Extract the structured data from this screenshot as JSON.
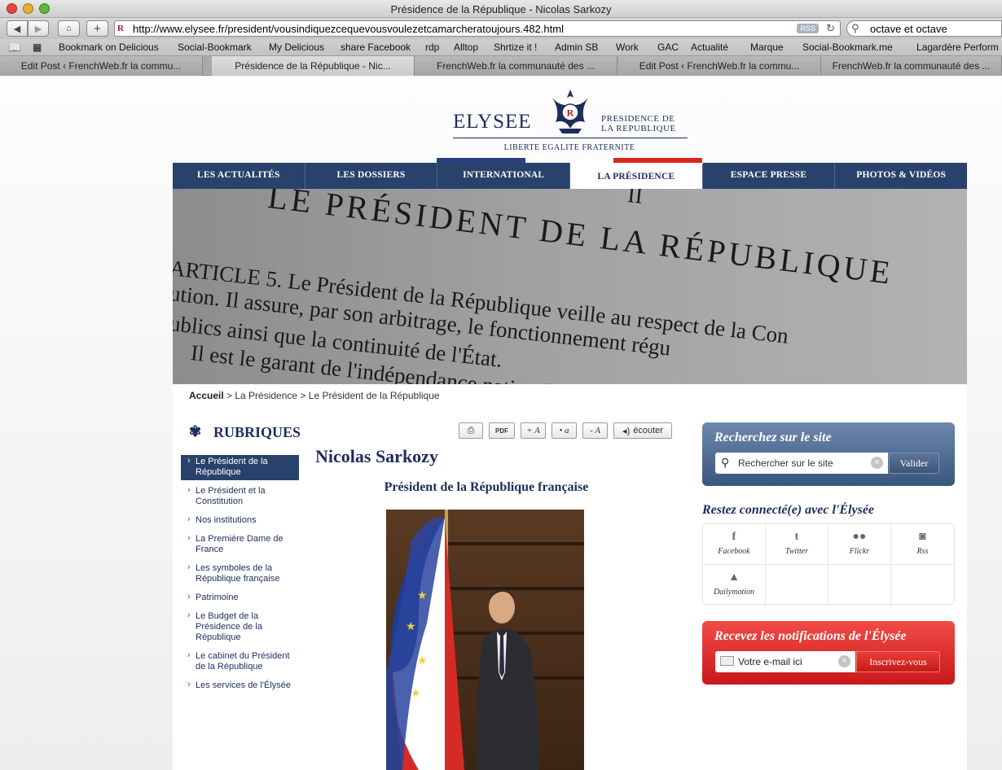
{
  "window": {
    "title": "Présidence de la République - Nicolas Sarkozy"
  },
  "toolbar": {
    "back_icon": "back-arrow-icon",
    "forward_icon": "forward-arrow-icon",
    "home_icon": "home-icon",
    "add_icon": "plus-icon",
    "url": "http://www.elysee.fr/president/vousindiquezcequevousvoulezetcamarcheratoujours.482.html",
    "rss_label": "RSS",
    "search_value": "octave et octave"
  },
  "bookmarks": [
    "Bookmark on Delicious",
    "Social-Bookmark",
    "My Delicious",
    "share Facebook",
    "rdp",
    "Alltop",
    "Shrtize it !",
    "Admin SB",
    "Work",
    "GAC",
    "Actualité",
    "Marque",
    "Social-Bookmark.me",
    "Lagardère Perform"
  ],
  "tabs": [
    {
      "label": "Edit Post ‹ FrenchWeb.fr la commu...",
      "active": false
    },
    {
      "label": "Présidence de la République - Nic...",
      "active": true
    },
    {
      "label": "FrenchWeb.fr la communauté des ...",
      "active": false
    },
    {
      "label": "Edit Post ‹ FrenchWeb.fr la commu...",
      "active": false
    },
    {
      "label": "FrenchWeb.fr la communauté des ...",
      "active": false
    }
  ],
  "site": {
    "logo_word": "ELYSEE",
    "logo_sub": [
      "PRESIDENCE DE",
      "LA REPUBLIQUE"
    ],
    "motto": "LIBERTE EGALITE FRATERNITE",
    "tricolor": [
      "#2a3f82",
      "#ffffff",
      "#d4261f"
    ]
  },
  "nav": [
    "LES ACTUALITÉS",
    "LES DOSSIERS",
    "INTERNATIONAL",
    "LA PRÉSIDENCE",
    "ESPACE PRESSE",
    "PHOTOS & VIDÉOS"
  ],
  "nav_active": "LA PRÉSIDENCE",
  "banner_lines": [
    "II",
    "LE PRÉSIDENT DE LA RÉPUBLIQUE",
    "ARTICLE 5.      Le Président de la République veille au respect de la Con",
    "ution. Il assure, par son arbitrage, le fonctionnement régu",
    "ublics ainsi que la continuité de l'État.",
    "Il est le garant de l'indépendance nationale,"
  ],
  "breadcrumb": {
    "home": "Accueil",
    "sep1": " > La Présidence > ",
    "current": "Le Président de la République"
  },
  "rubriques": {
    "title": "RUBRIQUES",
    "items": [
      {
        "label": "Le Président de la République",
        "active": true
      },
      {
        "label": "Le Président et la Constitution",
        "active": false
      },
      {
        "label": "Nos institutions",
        "active": false
      },
      {
        "label": "La Première Dame de France",
        "active": false
      },
      {
        "label": "Les symboles de la République française",
        "active": false
      },
      {
        "label": "Patrimoine",
        "active": false
      },
      {
        "label": "Le Budget de la Présidence de la République",
        "active": false
      },
      {
        "label": "Le cabinet du Président de la République",
        "active": false
      },
      {
        "label": "Les services de l'Élysée",
        "active": false
      }
    ]
  },
  "tools": {
    "print_icon": "printer-icon",
    "pdf": "PDF",
    "bigger": "+ A",
    "reset": "• a",
    "smaller": "- A",
    "listen": "écouter"
  },
  "article": {
    "name": "Nicolas Sarkozy",
    "subtitle": "Président de la République française"
  },
  "search": {
    "title": "Recherchez sur le site",
    "placeholder": "Rechercher sur le site",
    "button": "Valider"
  },
  "social": {
    "title": "Restez connecté(e) avec l'Élysée",
    "items": [
      {
        "label": "Facebook",
        "icon": "facebook-icon",
        "glyph": "f"
      },
      {
        "label": "Twitter",
        "icon": "twitter-icon",
        "glyph": "t"
      },
      {
        "label": "Flickr",
        "icon": "flickr-icon",
        "glyph": "●●"
      },
      {
        "label": "Rss",
        "icon": "rss-icon",
        "glyph": "◙"
      },
      {
        "label": "Dailymotion",
        "icon": "dailymotion-icon",
        "glyph": "▲"
      }
    ]
  },
  "notif": {
    "title": "Recevez les notifications de l'Élysée",
    "placeholder": "Votre e-mail ici",
    "button": "Inscrivez-vous"
  }
}
